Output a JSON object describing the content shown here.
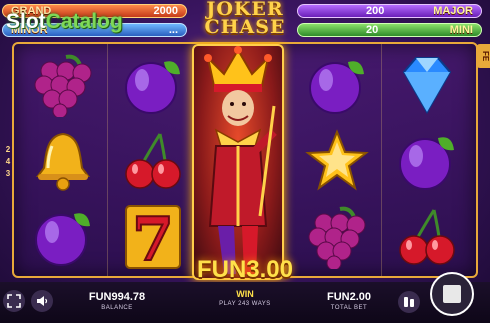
{
  "brand": {
    "part1": "Slot",
    "part2": "Catalog"
  },
  "game_logo": {
    "line1": "JOKER",
    "line2": "CHASE"
  },
  "jackpots": {
    "grand": {
      "name": "GRAND",
      "value": "2000"
    },
    "minor": {
      "name": "MINOR",
      "value": "..."
    },
    "major": {
      "name": "MAJOR",
      "value": "200"
    },
    "mini": {
      "name": "MINI",
      "value": "20"
    }
  },
  "side_ways": [
    "2",
    "4",
    "3"
  ],
  "feature_tab": "FE",
  "win": {
    "amount": "FUN3.00",
    "label": "WIN",
    "ways": "PLAY 243 WAYS"
  },
  "balance": {
    "value": "FUN994.78",
    "label": "BALANCE"
  },
  "total_bet": {
    "value": "FUN2.00",
    "label": "TOTAL BET"
  },
  "icons": [
    "fullscreen-icon",
    "sound-icon",
    "bet-stack-icon",
    "spin-stop-icon"
  ],
  "colors": {
    "gold": "#ffd24a",
    "reel_bg": "#3a1560",
    "frame": "#e8a93a"
  }
}
